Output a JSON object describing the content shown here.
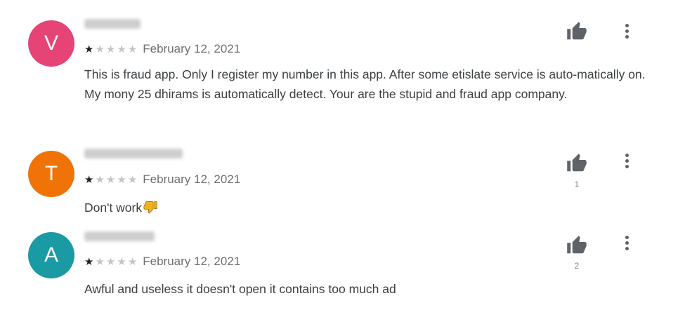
{
  "reviews": [
    {
      "avatar_letter": "V",
      "avatar_color": "#e64377",
      "rating": 1,
      "date": "February 12, 2021",
      "text": "This is fraud app. Only I register my number in this app. After some etislate service is auto-matically on. My mony 25 dhirams is automatically detect. Your are the stupid and fraud app company.",
      "helpful_count": ""
    },
    {
      "avatar_letter": "T",
      "avatar_color": "#ef7306",
      "rating": 1,
      "date": "February 12, 2021",
      "text": "Don't work",
      "helpful_count": "1"
    },
    {
      "avatar_letter": "A",
      "avatar_color": "#1a9aa3",
      "rating": 1,
      "date": "February 12, 2021",
      "text": "Awful and useless it doesn't open it contains too much ad",
      "helpful_count": "2"
    }
  ],
  "icons": {
    "like": "thumb-up-icon",
    "more": "more-vert-icon",
    "emoji": "thumbs-down-emoji-icon"
  },
  "colors": {
    "star_filled": "#202124",
    "star_empty": "#c5c5c5",
    "emoji": "#f2b01e"
  }
}
